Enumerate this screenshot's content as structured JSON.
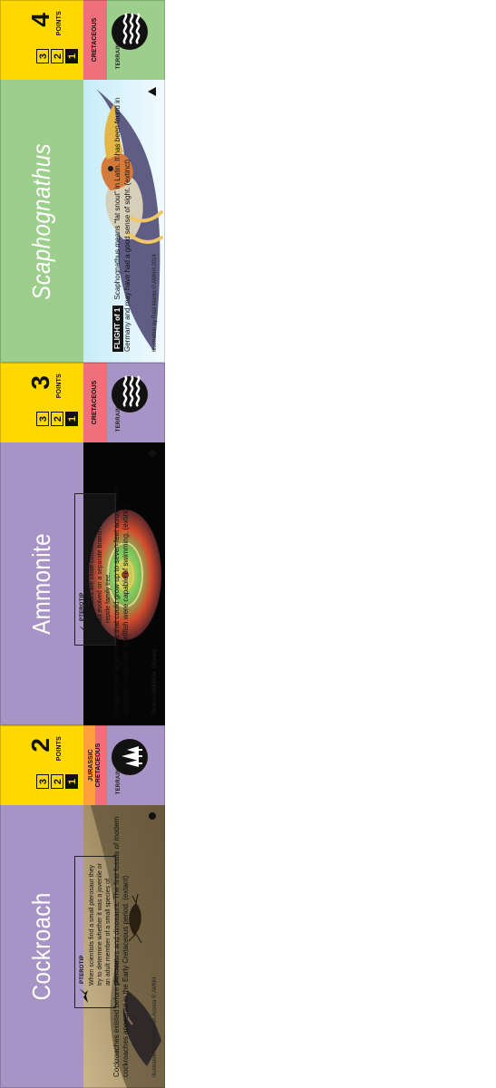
{
  "cards": [
    {
      "id": "pterosaur",
      "title": "Scaphognathus",
      "points": "4",
      "points_word": "POINTS",
      "levels": [
        "3",
        "2",
        "1"
      ],
      "era": [
        "CRETACEOUS"
      ],
      "terrain_label": "TERRAIN:",
      "tag": "FLIGHT of 1",
      "description": "Scaphognathus means “fat snout” in Latin. It has been found in Germany and may have had a good sense of sight. (extinct)",
      "credit": "Illustration by Raul Martin © AMNH 2014",
      "symbol": "triangle",
      "colors": {
        "bg": "#9ccf8b",
        "era": "#ef6f7b",
        "points_box": "#ffd800"
      }
    },
    {
      "id": "ammonite",
      "title": "Ammonite",
      "points": "3",
      "points_word": "POINTS",
      "levels": [
        "3",
        "2",
        "1"
      ],
      "era": [
        "CRETACEOUS"
      ],
      "terrain_label": "TERRAIN:",
      "description": "Despite their large shells that could grow up to seven feet across, these predatory, squid-like shellfish were capable of swimming. (extinct)",
      "note": {
        "label": "PTEROTIP",
        "text": "Pterosaurs are close cousins of dinosaurs, but evolved on a separate branch of the reptile family tree."
      },
      "credit": "Photo © AMNH/M. Shanley",
      "symbol": "dot",
      "colors": {
        "bg": "#a893c6",
        "era": "#ef6f7b",
        "points_box": "#ffd800"
      }
    },
    {
      "id": "cockroach",
      "title": "Cockroach",
      "points": "2",
      "points_word": "POINTS",
      "levels": [
        "3",
        "2",
        "1"
      ],
      "era": [
        "JURASSIC",
        "CRETACEOUS"
      ],
      "terrain_label": "TERRAIN:",
      "description": "Cockroaches existed before pterosaurs and dinosaurs. The first fossils of modern cockroaches appeared in the Early Cretaceous period. (extant)",
      "note": {
        "label": "PTEROTIP",
        "text": "When scientists find a small pterosaur they try to determine whether it was a juvenile or an adult member of a small species of pterosaur."
      },
      "credit": "Illustration by Constantin Acosta © AMNH",
      "symbol": "dot",
      "colors": {
        "bg": "#a893c6",
        "era_top": "#ff9f3f",
        "era_bottom": "#ef6f7b",
        "points_box": "#ffd800"
      }
    }
  ]
}
